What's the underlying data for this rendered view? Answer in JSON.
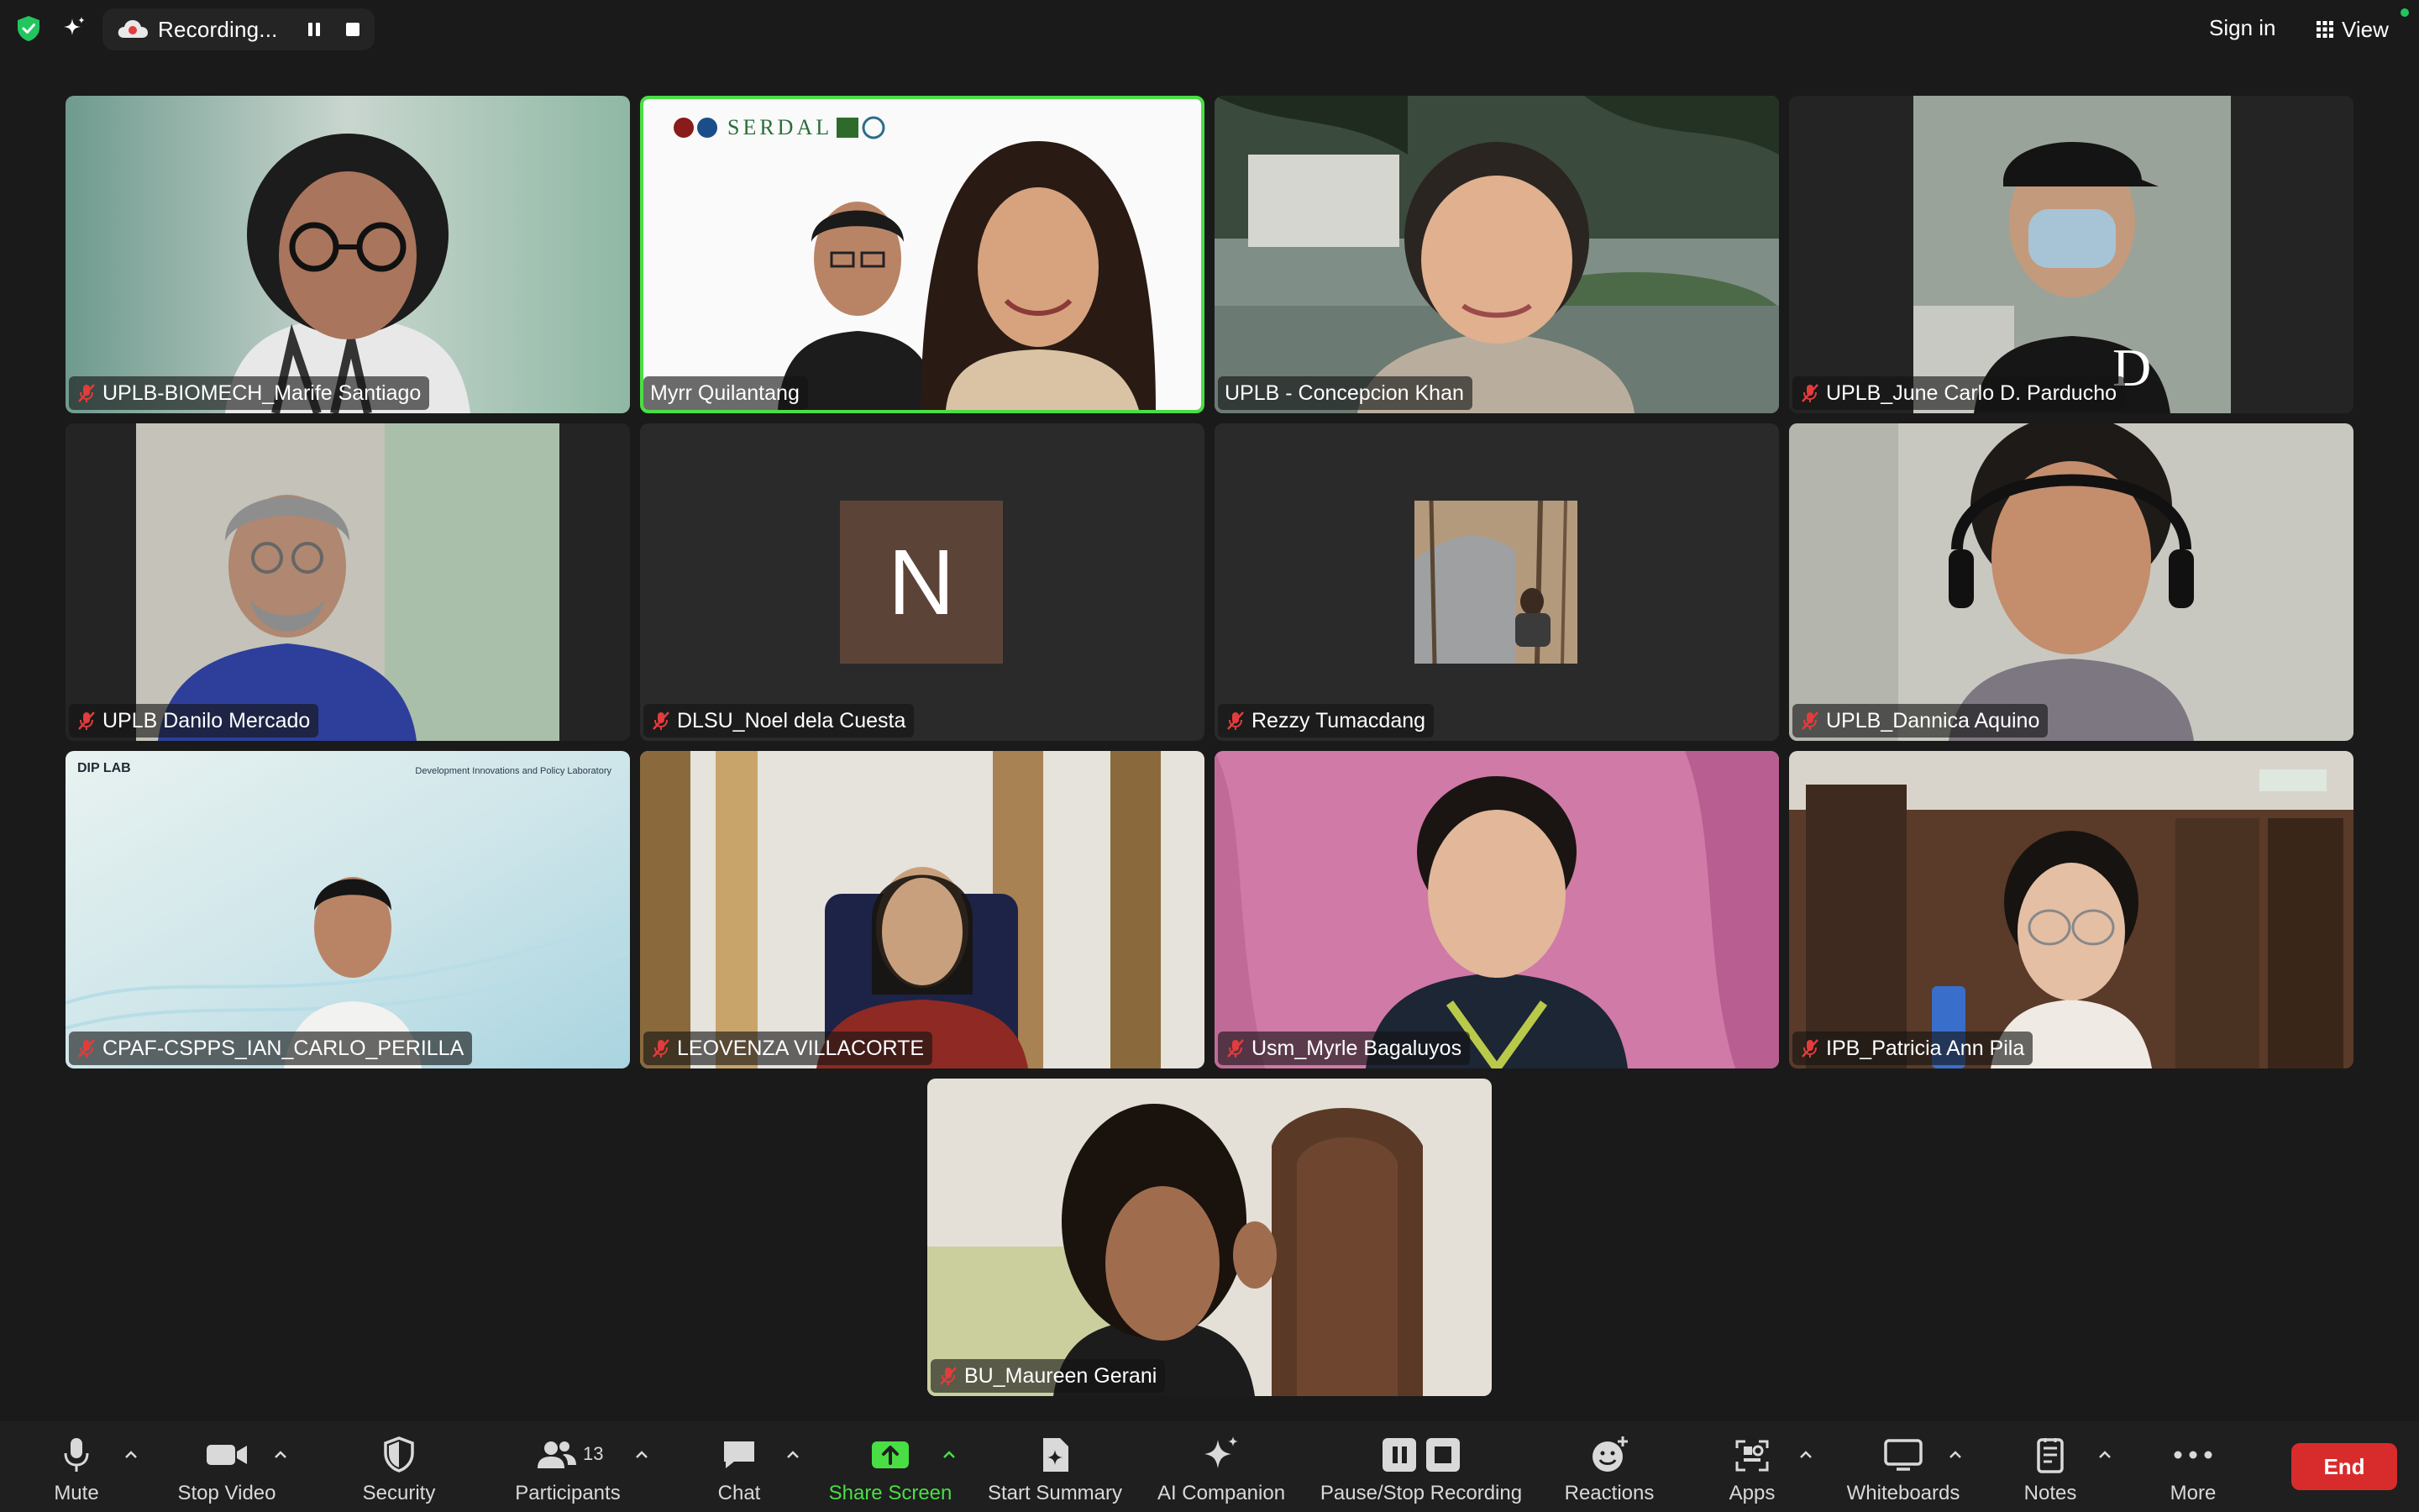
{
  "topbar": {
    "recording_label": "Recording...",
    "sign_in": "Sign in",
    "view": "View"
  },
  "participants": [
    {
      "name": "UPLB-BIOMECH_Marife Santiago",
      "muted": true
    },
    {
      "name": "Myrr Quilantang",
      "muted": false,
      "active_speaker": true,
      "background_text": "SERDAL"
    },
    {
      "name": "UPLB - Concepcion Khan",
      "muted": false
    },
    {
      "name": "UPLB_June Carlo D. Parducho",
      "muted": true
    },
    {
      "name": "UPLB Danilo Mercado",
      "muted": true
    },
    {
      "name": "DLSU_Noel dela Cuesta",
      "muted": true,
      "avatar_letter": "N"
    },
    {
      "name": "Rezzy Tumacdang",
      "muted": true
    },
    {
      "name": "UPLB_Dannica Aquino",
      "muted": true
    },
    {
      "name": "CPAF-CSPPS_IAN_CARLO_PERILLA",
      "muted": true,
      "background_text": "Development Innovations and Policy Laboratory",
      "background_logo": "DIP LAB"
    },
    {
      "name": "LEOVENZA VILLACORTE",
      "muted": true
    },
    {
      "name": "Usm_Myrle Bagaluyos",
      "muted": true
    },
    {
      "name": "IPB_Patricia Ann Pila",
      "muted": true
    },
    {
      "name": "BU_Maureen Gerani",
      "muted": true
    }
  ],
  "toolbar": {
    "mute": "Mute",
    "stop_video": "Stop Video",
    "security": "Security",
    "participants": "Participants",
    "participants_count": "13",
    "chat": "Chat",
    "share_screen": "Share Screen",
    "start_summary": "Start Summary",
    "ai_companion": "AI Companion",
    "pause_stop_recording": "Pause/Stop Recording",
    "reactions": "Reactions",
    "apps": "Apps",
    "whiteboards": "Whiteboards",
    "notes": "Notes",
    "more": "More",
    "end": "End"
  },
  "colors": {
    "background": "#1a1a1a",
    "active_speaker_border": "#4ade45",
    "share_green": "#4ade45",
    "end_red": "#d82c2c",
    "avatar_brown": "#5c4338"
  },
  "icons": [
    "shield-check-icon",
    "sparkle-icon",
    "cloud-record-icon",
    "pause-icon",
    "stop-icon",
    "grid-view-icon",
    "mic-off-icon",
    "microphone-icon",
    "video-camera-icon",
    "shield-icon",
    "participants-icon",
    "chat-bubble-icon",
    "share-screen-icon",
    "summary-icon",
    "ai-sparkle-icon",
    "reactions-icon",
    "apps-icon",
    "whiteboard-icon",
    "notes-icon",
    "more-dots-icon",
    "caret-up-icon"
  ]
}
